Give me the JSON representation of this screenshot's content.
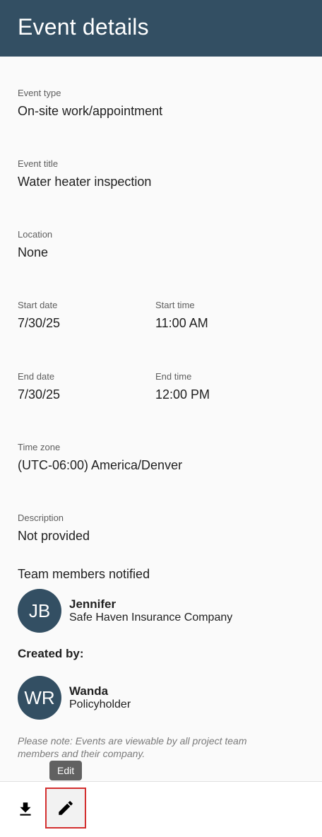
{
  "header": {
    "title": "Event details"
  },
  "fields": {
    "event_type": {
      "label": "Event type",
      "value": "On-site work/appointment"
    },
    "event_title": {
      "label": "Event title",
      "value": "Water heater inspection"
    },
    "location": {
      "label": "Location",
      "value": "None"
    },
    "start_date": {
      "label": "Start date",
      "value": "7/30/25"
    },
    "start_time": {
      "label": "Start time",
      "value": "11:00 AM"
    },
    "end_date": {
      "label": "End date",
      "value": "7/30/25"
    },
    "end_time": {
      "label": "End time",
      "value": "12:00 PM"
    },
    "time_zone": {
      "label": "Time zone",
      "value": "(UTC-06:00) America/Denver"
    },
    "description": {
      "label": "Description",
      "value": "Not provided"
    }
  },
  "team": {
    "title": "Team members notified",
    "members": [
      {
        "initials": "JB",
        "name": "Jennifer",
        "org": "Safe Haven Insurance Company"
      }
    ]
  },
  "created_by": {
    "title": "Created by:",
    "initials": "WR",
    "name": "Wanda",
    "org": "Policyholder"
  },
  "note": "Please note: Events are viewable by all project team members and their company.",
  "toolbar": {
    "download_icon": "download-icon",
    "edit_icon": "pencil-icon",
    "edit_tooltip": "Edit"
  },
  "colors": {
    "header_bg": "#334f63",
    "avatar_bg": "#334f63",
    "highlight": "#d32f2f"
  }
}
